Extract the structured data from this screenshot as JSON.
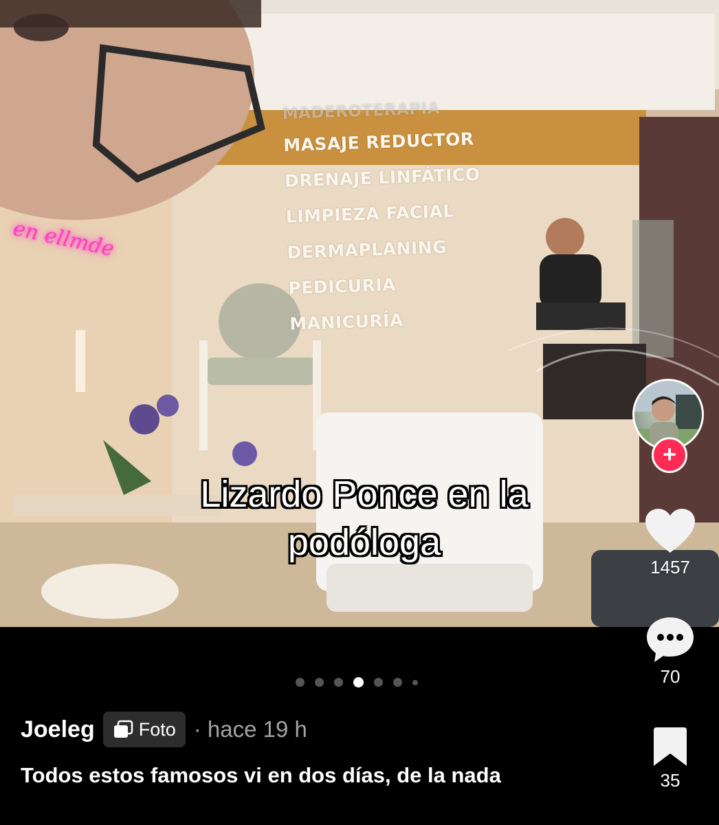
{
  "photo": {
    "menu_items": [
      "MADEROTERAPIA",
      "MASAJE REDUCTOR",
      "DRENAJE LINFÁTICO",
      "LIMPIEZA FACIAL",
      "DERMAPLANING",
      "PEDICURIA",
      "MANICURÍA"
    ],
    "overlay_line1": "Lizardo Ponce en la",
    "overlay_line2": "podóloga"
  },
  "actions": {
    "likes": "1457",
    "comments": "70",
    "saves": "35",
    "follow_symbol": "+"
  },
  "carousel": {
    "total": 7,
    "active_index": 3
  },
  "post": {
    "author": "Joeleg",
    "badge_label": "Foto",
    "meta": "· hace 19 h",
    "description": "Todos estos famosos vi en dos días, de la nada"
  },
  "colors": {
    "follow": "#fe2c55",
    "badge_bg": "#2d2d2d",
    "meta": "#a3a3a3"
  },
  "icons": [
    "heart-icon",
    "comment-icon",
    "bookmark-icon",
    "photo-icon",
    "plus-icon"
  ]
}
